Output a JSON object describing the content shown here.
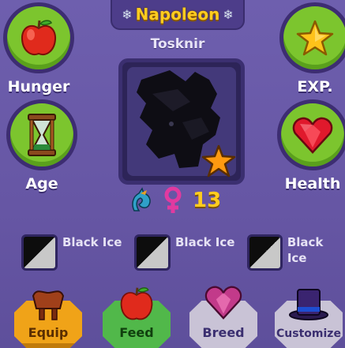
{
  "header": {
    "pet_name": "Napoleon",
    "breed_name": "Tosknir"
  },
  "stats": {
    "hunger": {
      "label": "Hunger",
      "icon": "apple-icon"
    },
    "exp": {
      "label": "EXP.",
      "icon": "star-icon"
    },
    "age": {
      "label": "Age",
      "icon": "hourglass-icon"
    },
    "health": {
      "label": "Health",
      "icon": "heart-gem-icon"
    }
  },
  "portrait": {
    "badge_icon": "star-icon"
  },
  "info": {
    "species_icon": "dragon-icon",
    "gender_icon": "female-icon",
    "level": "13"
  },
  "genes": [
    {
      "name": "Black Ice"
    },
    {
      "name": "Black Ice"
    },
    {
      "name": "Black Ice"
    }
  ],
  "actions": {
    "equip": "Equip",
    "feed": "Feed",
    "breed": "Breed",
    "customize": "Customize"
  },
  "colors": {
    "accent_gold": "#ffcc1f",
    "stat_green": "#7cc52e",
    "panel": "#6a5aa8"
  }
}
